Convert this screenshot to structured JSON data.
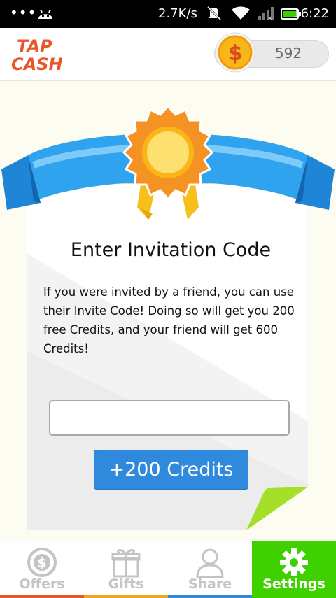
{
  "status_bar": {
    "speed": "2.7K/s",
    "time": "16:22"
  },
  "header": {
    "logo_text_top": "TAP",
    "logo_text_bottom": "CASH",
    "coin_symbol": "$",
    "credits": "592"
  },
  "card": {
    "title": "Enter Invitation Code",
    "description": "If you were invited by a friend, you can use their Invite Code! Doing so will get you 200 free Credits, and your friend will get 600 Credits!",
    "input_value": "",
    "button_label": "+200 Credits"
  },
  "nav": {
    "items": [
      {
        "label": "Offers",
        "icon": "dollar-coin-icon",
        "bar_color": "#e8572b"
      },
      {
        "label": "Gifts",
        "icon": "gift-icon",
        "bar_color": "#f2a51f"
      },
      {
        "label": "Share",
        "icon": "person-icon",
        "bar_color": "#2f89dc"
      },
      {
        "label": "Settings",
        "icon": "gear-icon",
        "bar_color": "#3fd000"
      }
    ],
    "active": "Settings"
  },
  "colors": {
    "accent_blue": "#2f89dc",
    "active_tab": "#3fd000",
    "logo_orange": "#e8572b"
  }
}
